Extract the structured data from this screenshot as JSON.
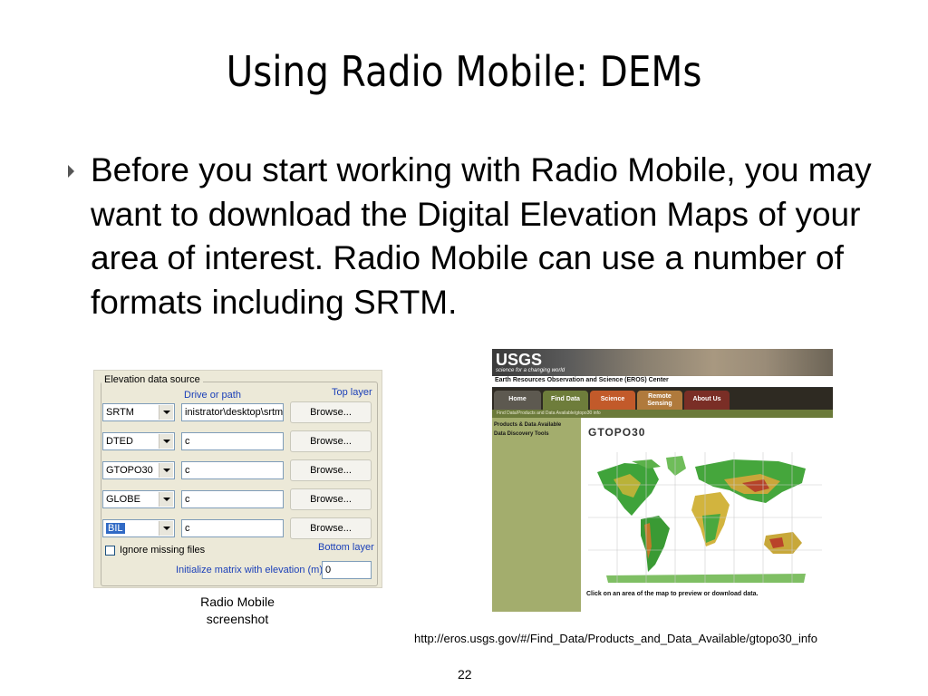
{
  "slide": {
    "title": "Using Radio Mobile: DEMs",
    "bullet": "Before you start working with Radio Mobile, you may want to download the Digital Elevation Maps of your area of interest. Radio Mobile can use a number of formats including SRTM.",
    "caption_line1": "Radio Mobile",
    "caption_line2": "screenshot",
    "url": "http://eros.usgs.gov/#/Find_Data/Products_and_Data_Available/gtopo30_info",
    "page_number": "22"
  },
  "radio_mobile": {
    "group_label": "Elevation data source",
    "drive_label": "Drive or path",
    "top_layer": "Top layer",
    "bottom_layer": "Bottom layer",
    "rows": [
      {
        "format": "SRTM",
        "path": "inistrator\\desktop\\srtm",
        "button": "Browse..."
      },
      {
        "format": "DTED",
        "path": "c",
        "button": "Browse..."
      },
      {
        "format": "GTOPO30",
        "path": "c",
        "button": "Browse..."
      },
      {
        "format": "GLOBE",
        "path": "c",
        "button": "Browse..."
      },
      {
        "format": "BIL",
        "path": "c",
        "button": "Browse..."
      }
    ],
    "ignore_missing": "Ignore missing files",
    "init_label": "Initialize matrix with elevation (m)",
    "init_value": "0"
  },
  "usgs": {
    "logo": "USGS",
    "tagline": "science for a changing world",
    "center": "Earth Resources Observation and Science (EROS) Center",
    "tabs": [
      "Home",
      "Find Data",
      "Science",
      "Remote Sensing",
      "About Us"
    ],
    "breadcrumb": "Find Data/Products and Data Available/gtopo30 info",
    "left_links": [
      "Products & Data Available",
      "Data Discovery Tools"
    ],
    "heading": "GTOPO30",
    "click_text": "Click on an area of the map to preview or download data.",
    "colors": {
      "home_tab": "#5d5950",
      "find_tab": "#6e7d3b",
      "science_tab": "#c25a2a",
      "remote_tab": "#b07a3c",
      "about_tab": "#7a2e26"
    }
  }
}
